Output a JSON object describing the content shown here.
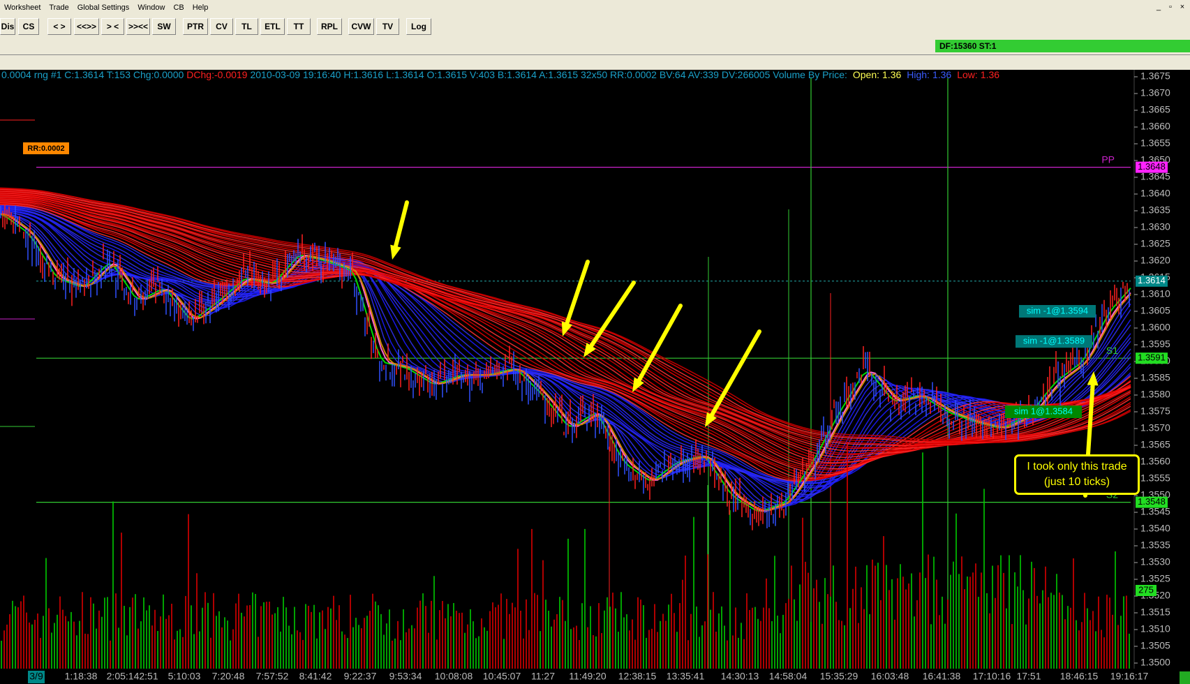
{
  "menu": [
    "Worksheet",
    "Trade",
    "Global Settings",
    "Window",
    "CB",
    "Help"
  ],
  "window_controls": [
    "_",
    "▫",
    "×"
  ],
  "toolbar": [
    "Dis",
    "CS",
    "< >",
    "<<>>",
    "> <",
    ">><<",
    "SW",
    "PTR",
    "CV",
    "TL",
    "ETL",
    "TT",
    "RPL",
    "CVW",
    "TV",
    "Log"
  ],
  "status": {
    "df": "DF:15360  ST:1"
  },
  "info_line": {
    "main": "0.0004 rng  #1 C:1.3614 T:153 Chg:0.0000",
    "dchg": "DChg:-0.0019",
    "rest": "2010-03-09 19:16:40 H:1.3616 L:1.3614 O:1.3615 V:403 B:1.3614 A:1.3615 32x50 RR:0.0002 BV:64 AV:339 DV:266005 Volume By Price:",
    "open_label": "Open:",
    "open_val": "1.36",
    "high_label": "High:",
    "high_val": "1.36",
    "low_label": "Low:",
    "low_val": "1.36"
  },
  "rr_tag": "RR:0.0002",
  "annotation": {
    "line1": "I took only this trade",
    "line2": "(just 10 ticks)"
  },
  "colors": {
    "bull": "#00ee00",
    "bear": "#ff2020",
    "ribbon_bear": "#ff0000",
    "ribbon_bull": "#1a1aff",
    "pivot": "#cc22cc",
    "level": "#33cc33",
    "arrow": "#ffff00"
  },
  "chart_data": {
    "type": "candlestick",
    "y_axis": {
      "min": 1.35,
      "max": 1.3675,
      "step": 0.0005,
      "ticks": [
        "1.3675",
        "1.3670",
        "1.3665",
        "1.3660",
        "1.3655",
        "1.3650",
        "1.3645",
        "1.3640",
        "1.3635",
        "1.3630",
        "1.3625",
        "1.3620",
        "1.3615",
        "1.3610",
        "1.3605",
        "1.3600",
        "1.3595",
        "1.3590",
        "1.3585",
        "1.3580",
        "1.3575",
        "1.3570",
        "1.3565",
        "1.3560",
        "1.3555",
        "1.3550",
        "1.3545",
        "1.3540",
        "1.3535",
        "1.3530",
        "1.3525",
        "1.3520",
        "1.3515",
        "1.3510",
        "1.3505",
        "1.3500"
      ]
    },
    "x_labels": [
      "3/9",
      "1:18:38",
      "2:05:14",
      "2:51",
      "5:10:03",
      "7:20:48",
      "7:57:52",
      "8:41:42",
      "9:22:37",
      "9:53:34",
      "10:08:08",
      "10:45:07",
      "11:27",
      "11:49:20",
      "12:38:15",
      "13:35:41",
      "14:30:13",
      "14:58:04",
      "15:35:29",
      "16:03:48",
      "16:41:38",
      "17:10:16",
      "17:51",
      "18:46:15",
      "19:16:17"
    ],
    "price_path": [
      1.3634,
      1.3628,
      1.3615,
      1.3612,
      1.362,
      1.3608,
      1.3612,
      1.3602,
      1.3608,
      1.3615,
      1.3613,
      1.3622,
      1.362,
      1.3617,
      1.359,
      1.3588,
      1.3583,
      1.3586,
      1.3586,
      1.3588,
      1.358,
      1.357,
      1.3575,
      1.356,
      1.3554,
      1.356,
      1.3562,
      1.355,
      1.3545,
      1.3548,
      1.356,
      1.3575,
      1.3588,
      1.3578,
      1.358,
      1.3575,
      1.3572,
      1.357,
      1.3574,
      1.3584,
      1.359,
      1.3605,
      1.3614
    ],
    "current_price": "1.3614",
    "levels": [
      {
        "name": "PP",
        "value": 1.3648,
        "label": "1.3648"
      },
      {
        "name": "S1",
        "value": 1.3591,
        "label": "1.3591"
      },
      {
        "name": "S2",
        "value": 1.3548,
        "label": "1.3548"
      }
    ],
    "level_names": [
      "PP",
      "S1",
      "S2"
    ],
    "trades": [
      {
        "label": "sim -1@1.3594",
        "value": 1.3605
      },
      {
        "label": "sim -1@1.3589",
        "value": 1.3596
      },
      {
        "label": "sim 1@1.3584",
        "value": 1.3575
      }
    ],
    "volume_last": "275"
  }
}
